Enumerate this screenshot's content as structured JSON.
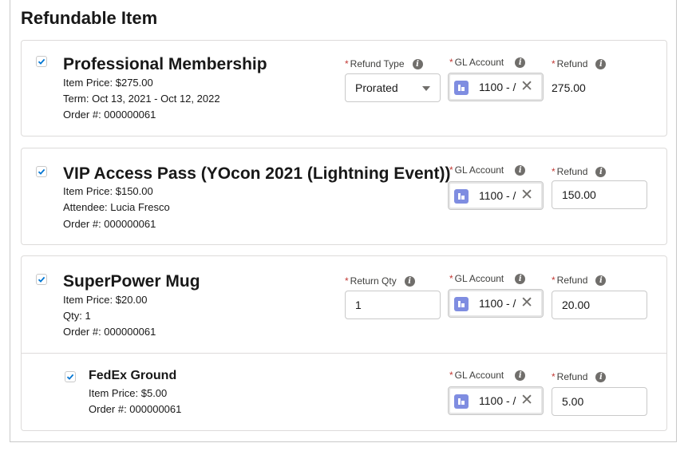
{
  "heading": "Refundable Item",
  "labels": {
    "refund_type": "Refund Type",
    "gl_account": "GL Account",
    "refund": "Refund",
    "return_qty": "Return Qty",
    "required_marker": "*",
    "info_glyph": "i"
  },
  "items": [
    {
      "title": "Professional Membership",
      "price": "Item Price: $275.00",
      "line2": "Term: Oct 13, 2021 - Oct 12, 2022",
      "order": "Order #: 000000061",
      "checked": true,
      "refund_type_value": "Prorated",
      "gl_account_value": "1100 - /",
      "refund_value": "275.00"
    },
    {
      "title": "VIP Access Pass (YOcon 2021 (Lightning Event))",
      "price": "Item Price: $150.00",
      "line2": "Attendee:  Lucia Fresco",
      "order": "Order #: 000000061",
      "checked": true,
      "gl_account_value": "1100 - /",
      "refund_value": "150.00"
    },
    {
      "title": "SuperPower Mug",
      "price": "Item Price: $20.00",
      "line2": "Qty: 1",
      "order": "Order #: 000000061",
      "checked": true,
      "return_qty_value": "1",
      "gl_account_value": "1100 - /",
      "refund_value": "20.00"
    },
    {
      "title": "FedEx Ground",
      "price": "Item Price: $5.00",
      "order": "Order #: 000000061",
      "checked": true,
      "gl_account_value": "1100 - /",
      "refund_value": "5.00"
    }
  ],
  "icons": {
    "checkbox": "check-icon",
    "info": "info-icon",
    "gl_account": "gl-account-icon",
    "clear": "close-icon",
    "dropdown": "chevron-down-icon"
  },
  "colors": {
    "check": "#0176d3",
    "required": "#c23934",
    "info_icon": "#706e6b",
    "gl_icon": "#7f8de1",
    "border": "#dddbda"
  },
  "clear_glyph": "✕"
}
